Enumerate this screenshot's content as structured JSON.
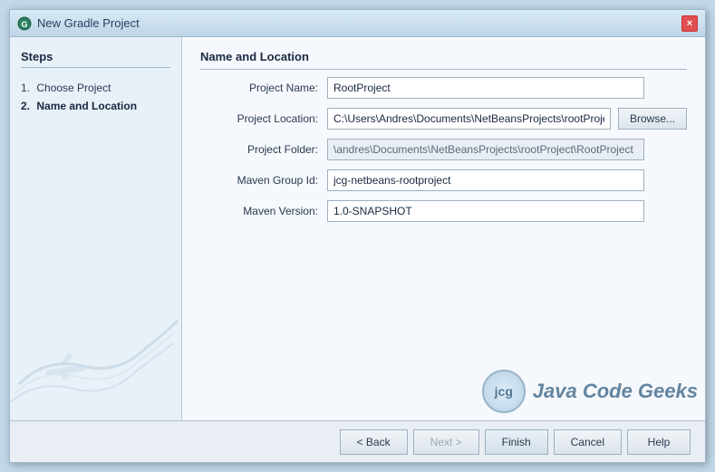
{
  "dialog": {
    "title": "New Gradle Project",
    "close_button_label": "×"
  },
  "steps": {
    "heading": "Steps",
    "items": [
      {
        "number": "1.",
        "label": "Choose Project",
        "active": false
      },
      {
        "number": "2.",
        "label": "Name and Location",
        "active": true
      }
    ]
  },
  "form": {
    "section_title": "Name and Location",
    "fields": [
      {
        "label": "Project Name:",
        "value": "RootProject",
        "readonly": false,
        "has_browse": false
      },
      {
        "label": "Project Location:",
        "value": "C:\\Users\\Andres\\Documents\\NetBeansProjects\\rootProject",
        "readonly": false,
        "has_browse": true
      },
      {
        "label": "Project Folder:",
        "value": "\\andres\\Documents\\NetBeansProjects\\rootProject\\RootProject",
        "readonly": true,
        "has_browse": false
      },
      {
        "label": "Maven Group Id:",
        "value": "jcg-netbeans-rootproject",
        "readonly": false,
        "has_browse": false
      },
      {
        "label": "Maven Version:",
        "value": "1.0-SNAPSHOT",
        "readonly": false,
        "has_browse": false
      }
    ],
    "browse_label": "Browse..."
  },
  "footer": {
    "back_label": "< Back",
    "next_label": "Next >",
    "finish_label": "Finish",
    "cancel_label": "Cancel",
    "help_label": "Help"
  },
  "watermark": {
    "logo_text": "jcg",
    "brand_text": "Java Code Geeks"
  }
}
